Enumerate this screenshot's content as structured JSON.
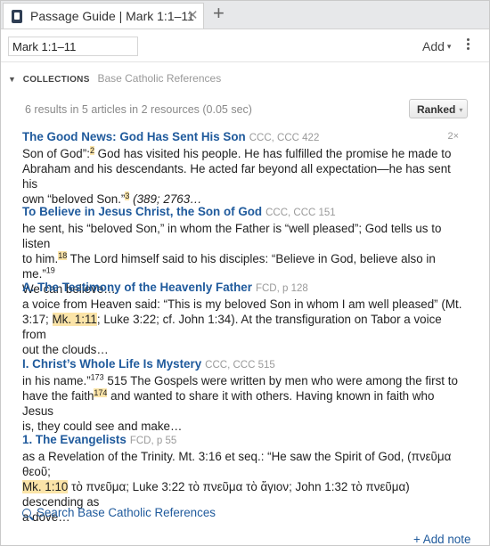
{
  "tab": {
    "title": "Passage Guide | Mark 1:1–11",
    "close_glyph": "✕",
    "add_glyph": "+"
  },
  "reference": {
    "value": "Mark 1:1–11"
  },
  "toolbar": {
    "add_label": "Add",
    "add_caret": "▾"
  },
  "collections": {
    "caret": "▼",
    "label": "COLLECTIONS",
    "name": "Base Catholic References"
  },
  "results_summary": "6 results in 5 articles in 2 resources (0.05 sec)",
  "sort": {
    "label": "Ranked",
    "caret": "▾"
  },
  "results": [
    {
      "title": "The Good News: God Has Sent His Son",
      "source": "CCC, CCC 422",
      "count": "2×",
      "l1": "Son of God”:",
      "l1_note": "2",
      "l1_b": " God has visited his people. He has fulfilled the promise he made to",
      "l2": "Abraham and his descendants. He acted far beyond all expectation—he has sent his",
      "l3": "own “beloved Son.”",
      "l3_note": "3",
      "l3_ref": " (389; 2763…"
    },
    {
      "title": "To Believe in Jesus Christ, the Son of God",
      "source": "CCC, CCC 151",
      "l1": "he sent, his “beloved Son,” in whom the Father is “well pleased”; God tells us to listen",
      "l2": "to him.",
      "l2_note": "18",
      "l2_b": " The Lord himself said to his disciples: “Believe in God, believe also in me.”",
      "l2_note2": "19",
      "l3": "We can believe…"
    },
    {
      "title": "A. The Testimony of the Heavenly Father",
      "source": "FCD, p 128",
      "l1": "a voice from Heaven said: “This is my beloved Son in whom I am well pleased” (Mt.",
      "l2": "3:17; ",
      "l2_hl": "Mk. 1:11",
      "l2_b": "; Luke 3:22; cf. John 1:34). At the transfiguration on Tabor a voice from",
      "l3": "out the clouds…"
    },
    {
      "title": "I. Christ’s Whole Life Is Mystery",
      "source": "CCC, CCC 515",
      "l1": "in his name.”",
      "l1_note": "173",
      "l1_b": " 515 The Gospels were written by men who were among the first to",
      "l2": "have the faith",
      "l2_note": "174",
      "l2_b": " and wanted to share it with others. Having known in faith who Jesus",
      "l3": "is, they could see and make…"
    },
    {
      "title": "1. The Evangelists",
      "source": "FCD, p 55",
      "l1": "as a Revelation of the Trinity. Mt. 3:16 et seq.: “He saw the Spirit of God, (πνεῦμα θεοῦ;",
      "l2_hl": "Mk. 1:10",
      "l2_b": " τὸ πνεῦμα; Luke 3:22 τὸ πνεῦμα τὸ ἅγιον; John 1:32 τὸ πνεῦμα) descending as",
      "l3": "a dove…"
    }
  ],
  "search_link": "Search Base Catholic References",
  "add_note": "+ Add note",
  "colors": {
    "link": "#1f5a9c",
    "highlight": "#fbe4a8",
    "muted": "#9a9a9a"
  }
}
